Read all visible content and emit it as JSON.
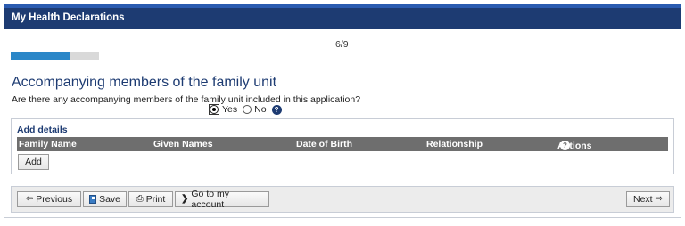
{
  "header": {
    "title": "My Health Declarations"
  },
  "progress": {
    "text": "6/9",
    "fraction": 0.6667,
    "accent": "#2b87c8"
  },
  "section": {
    "heading": "Accompanying members of the family unit",
    "question": "Are there any accompanying members of the family unit included in this application?",
    "options": [
      {
        "label": "Yes",
        "selected": true
      },
      {
        "label": "No",
        "selected": false
      }
    ]
  },
  "details": {
    "title": "Add details",
    "columns": [
      "Family Name",
      "Given Names",
      "Date of Birth",
      "Relationship",
      "Actions"
    ],
    "add_label": "Add"
  },
  "footer": {
    "previous_label": "Previous",
    "save_label": "Save",
    "print_label": "Print",
    "account_label": "Go to my account",
    "next_label": "Next"
  },
  "colors": {
    "title_bar": "#1d3b72",
    "table_header": "#6e6e6e"
  }
}
